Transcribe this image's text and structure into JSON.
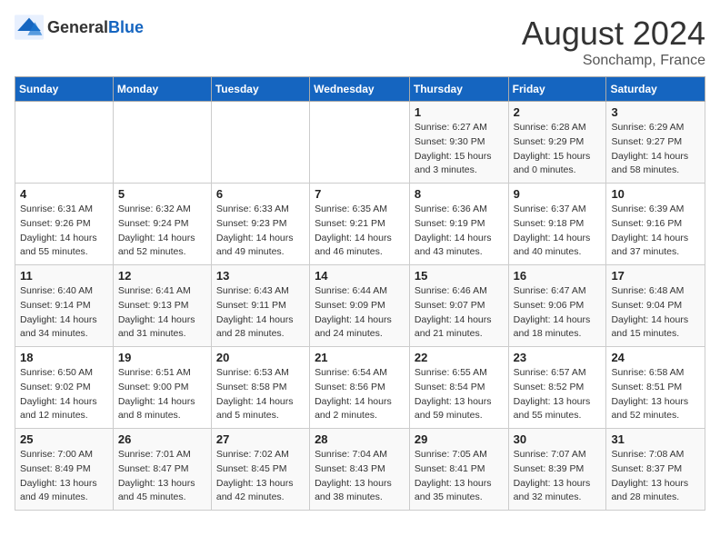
{
  "header": {
    "logo": {
      "general": "General",
      "blue": "Blue"
    },
    "title": "August 2024",
    "subtitle": "Sonchamp, France"
  },
  "weekdays": [
    "Sunday",
    "Monday",
    "Tuesday",
    "Wednesday",
    "Thursday",
    "Friday",
    "Saturday"
  ],
  "weeks": [
    [
      {
        "day": "",
        "details": ""
      },
      {
        "day": "",
        "details": ""
      },
      {
        "day": "",
        "details": ""
      },
      {
        "day": "",
        "details": ""
      },
      {
        "day": "1",
        "details": "Sunrise: 6:27 AM\nSunset: 9:30 PM\nDaylight: 15 hours\nand 3 minutes."
      },
      {
        "day": "2",
        "details": "Sunrise: 6:28 AM\nSunset: 9:29 PM\nDaylight: 15 hours\nand 0 minutes."
      },
      {
        "day": "3",
        "details": "Sunrise: 6:29 AM\nSunset: 9:27 PM\nDaylight: 14 hours\nand 58 minutes."
      }
    ],
    [
      {
        "day": "4",
        "details": "Sunrise: 6:31 AM\nSunset: 9:26 PM\nDaylight: 14 hours\nand 55 minutes."
      },
      {
        "day": "5",
        "details": "Sunrise: 6:32 AM\nSunset: 9:24 PM\nDaylight: 14 hours\nand 52 minutes."
      },
      {
        "day": "6",
        "details": "Sunrise: 6:33 AM\nSunset: 9:23 PM\nDaylight: 14 hours\nand 49 minutes."
      },
      {
        "day": "7",
        "details": "Sunrise: 6:35 AM\nSunset: 9:21 PM\nDaylight: 14 hours\nand 46 minutes."
      },
      {
        "day": "8",
        "details": "Sunrise: 6:36 AM\nSunset: 9:19 PM\nDaylight: 14 hours\nand 43 minutes."
      },
      {
        "day": "9",
        "details": "Sunrise: 6:37 AM\nSunset: 9:18 PM\nDaylight: 14 hours\nand 40 minutes."
      },
      {
        "day": "10",
        "details": "Sunrise: 6:39 AM\nSunset: 9:16 PM\nDaylight: 14 hours\nand 37 minutes."
      }
    ],
    [
      {
        "day": "11",
        "details": "Sunrise: 6:40 AM\nSunset: 9:14 PM\nDaylight: 14 hours\nand 34 minutes."
      },
      {
        "day": "12",
        "details": "Sunrise: 6:41 AM\nSunset: 9:13 PM\nDaylight: 14 hours\nand 31 minutes."
      },
      {
        "day": "13",
        "details": "Sunrise: 6:43 AM\nSunset: 9:11 PM\nDaylight: 14 hours\nand 28 minutes."
      },
      {
        "day": "14",
        "details": "Sunrise: 6:44 AM\nSunset: 9:09 PM\nDaylight: 14 hours\nand 24 minutes."
      },
      {
        "day": "15",
        "details": "Sunrise: 6:46 AM\nSunset: 9:07 PM\nDaylight: 14 hours\nand 21 minutes."
      },
      {
        "day": "16",
        "details": "Sunrise: 6:47 AM\nSunset: 9:06 PM\nDaylight: 14 hours\nand 18 minutes."
      },
      {
        "day": "17",
        "details": "Sunrise: 6:48 AM\nSunset: 9:04 PM\nDaylight: 14 hours\nand 15 minutes."
      }
    ],
    [
      {
        "day": "18",
        "details": "Sunrise: 6:50 AM\nSunset: 9:02 PM\nDaylight: 14 hours\nand 12 minutes."
      },
      {
        "day": "19",
        "details": "Sunrise: 6:51 AM\nSunset: 9:00 PM\nDaylight: 14 hours\nand 8 minutes."
      },
      {
        "day": "20",
        "details": "Sunrise: 6:53 AM\nSunset: 8:58 PM\nDaylight: 14 hours\nand 5 minutes."
      },
      {
        "day": "21",
        "details": "Sunrise: 6:54 AM\nSunset: 8:56 PM\nDaylight: 14 hours\nand 2 minutes."
      },
      {
        "day": "22",
        "details": "Sunrise: 6:55 AM\nSunset: 8:54 PM\nDaylight: 13 hours\nand 59 minutes."
      },
      {
        "day": "23",
        "details": "Sunrise: 6:57 AM\nSunset: 8:52 PM\nDaylight: 13 hours\nand 55 minutes."
      },
      {
        "day": "24",
        "details": "Sunrise: 6:58 AM\nSunset: 8:51 PM\nDaylight: 13 hours\nand 52 minutes."
      }
    ],
    [
      {
        "day": "25",
        "details": "Sunrise: 7:00 AM\nSunset: 8:49 PM\nDaylight: 13 hours\nand 49 minutes."
      },
      {
        "day": "26",
        "details": "Sunrise: 7:01 AM\nSunset: 8:47 PM\nDaylight: 13 hours\nand 45 minutes."
      },
      {
        "day": "27",
        "details": "Sunrise: 7:02 AM\nSunset: 8:45 PM\nDaylight: 13 hours\nand 42 minutes."
      },
      {
        "day": "28",
        "details": "Sunrise: 7:04 AM\nSunset: 8:43 PM\nDaylight: 13 hours\nand 38 minutes."
      },
      {
        "day": "29",
        "details": "Sunrise: 7:05 AM\nSunset: 8:41 PM\nDaylight: 13 hours\nand 35 minutes."
      },
      {
        "day": "30",
        "details": "Sunrise: 7:07 AM\nSunset: 8:39 PM\nDaylight: 13 hours\nand 32 minutes."
      },
      {
        "day": "31",
        "details": "Sunrise: 7:08 AM\nSunset: 8:37 PM\nDaylight: 13 hours\nand 28 minutes."
      }
    ]
  ]
}
